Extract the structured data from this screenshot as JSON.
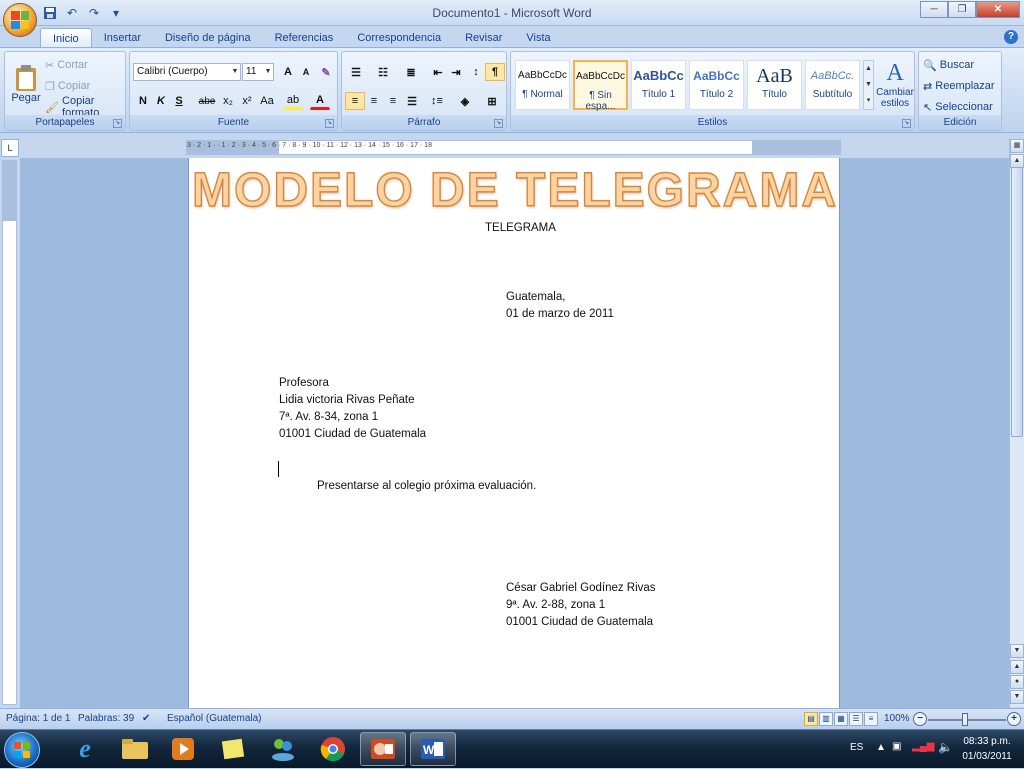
{
  "window": {
    "title": "Documento1 - Microsoft Word",
    "minimize": "─",
    "maximize": "❐",
    "close": "✕"
  },
  "qat": {
    "save": "💾",
    "undo": "↶",
    "redo": "↷",
    "customize": "▾"
  },
  "tabs": [
    {
      "label": "Inicio",
      "active": true
    },
    {
      "label": "Insertar"
    },
    {
      "label": "Diseño de página"
    },
    {
      "label": "Referencias"
    },
    {
      "label": "Correspondencia"
    },
    {
      "label": "Revisar"
    },
    {
      "label": "Vista"
    }
  ],
  "ribbon": {
    "clipboard": {
      "label": "Portapapeles",
      "paste": "Pegar",
      "cut": "Cortar",
      "copy": "Copiar",
      "format_painter": "Copiar formato"
    },
    "font": {
      "label": "Fuente",
      "family": "Calibri (Cuerpo)",
      "size": "11",
      "grow": "A",
      "shrink": "A",
      "clear": "✎",
      "bold": "N",
      "italic": "K",
      "underline": "S",
      "strike": "abe",
      "sub": "x₂",
      "sup": "x²",
      "case": "Aa",
      "highlight": "ab",
      "color": "A"
    },
    "paragraph": {
      "label": "Párrafo",
      "pilcrow": "¶",
      "sort": "↕"
    },
    "styles": {
      "label": "Estilos",
      "items": [
        {
          "preview": "AaBbCcDc",
          "name": "¶ Normal"
        },
        {
          "preview": "AaBbCcDc",
          "name": "¶ Sin espa...",
          "selected": true
        },
        {
          "preview": "AaBbCc",
          "name": "Título 1"
        },
        {
          "preview": "AaBbCc",
          "name": "Título 2"
        },
        {
          "preview": "AaB",
          "name": "Título"
        },
        {
          "preview": "AaBbCc.",
          "name": "Subtítulo"
        }
      ],
      "change_styles": "Cambiar estilos"
    },
    "editing": {
      "label": "Edición",
      "find": "Buscar",
      "replace": "Reemplazar",
      "select": "Seleccionar"
    }
  },
  "document": {
    "heading": "MODELO DE TELEGRAMA",
    "subtitle": "TELEGRAMA",
    "place": "Guatemala,",
    "date": "01 de marzo de 2011",
    "recipient": [
      "Profesora",
      "Lidia victoria Rivas Peñate",
      "7ª. Av. 8-34, zona 1",
      "01001 Ciudad de Guatemala"
    ],
    "body": "Presentarse al colegio próxima evaluación.",
    "sender": [
      "César Gabriel Godínez Rivas",
      "9ª. Av. 2-88, zona 1",
      "01001 Ciudad de Guatemala"
    ]
  },
  "ruler": {
    "marks": "3 · 2 · 1 · · 1 · 2 · 3 · 4 · 5 · 6 · 7 · 8 · 9 · 10 · 11 · 12 · 13 · 14 · 15 · 16 · 17 · 18"
  },
  "status": {
    "page": "Página: 1 de 1",
    "words": "Palabras: 39",
    "language": "Español (Guatemala)",
    "zoom": "100%"
  },
  "taskbar": {
    "apps": [
      "IE",
      "Explorer",
      "Media",
      "Sticky",
      "Messenger",
      "Chrome",
      "PowerPoint",
      "Word"
    ],
    "lang": "ES",
    "time": "08:33 p.m.",
    "date": "01/03/2011"
  }
}
